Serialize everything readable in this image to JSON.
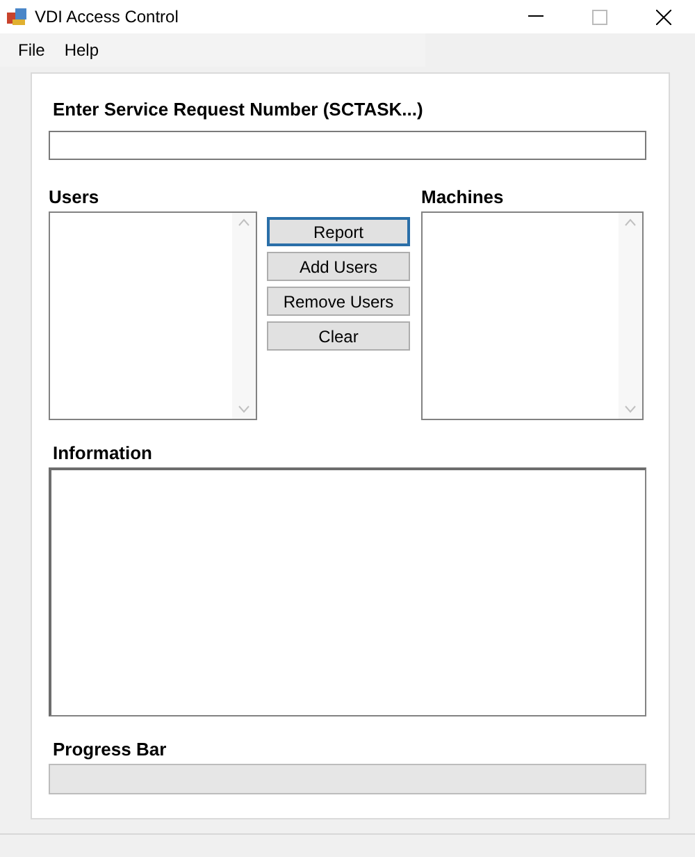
{
  "window": {
    "title": "VDI Access Control"
  },
  "menu": [
    {
      "label": "File"
    },
    {
      "label": "Help"
    }
  ],
  "request": {
    "label": "Enter Service Request Number (SCTASK...)"
  },
  "users": {
    "label": "Users"
  },
  "machines": {
    "label": "Machines"
  },
  "buttons": [
    {
      "label": "Report",
      "focused": true
    },
    {
      "label": "Add Users",
      "focused": false
    },
    {
      "label": "Remove Users",
      "focused": false
    },
    {
      "label": "Clear",
      "focused": false
    }
  ],
  "information": {
    "label": "Information"
  },
  "progress": {
    "label": "Progress Bar",
    "level": 0
  }
}
